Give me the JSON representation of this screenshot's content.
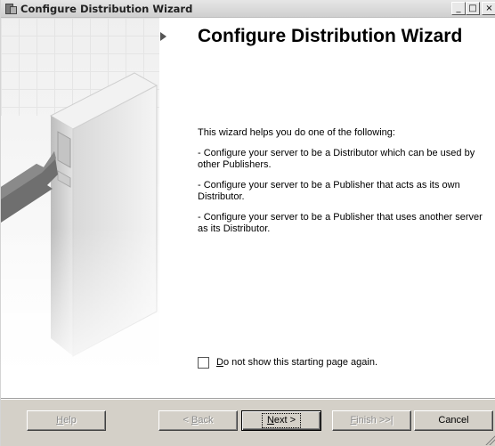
{
  "window": {
    "title": "Configure Distribution Wizard",
    "controls": {
      "minimize": "_",
      "maximize": "□",
      "close": "×"
    }
  },
  "page": {
    "heading": "Configure Distribution Wizard",
    "intro": "This wizard helps you do one of the following:",
    "options": [
      "- Configure your server to be a Distributor which can be used by other Publishers.",
      "- Configure your server to be a Publisher that acts as its own Distributor.",
      "- Configure your server to be a Publisher that uses another server as its Distributor."
    ],
    "checkbox": {
      "hotkey": "D",
      "rest": "o not show this starting page again.",
      "checked": false
    }
  },
  "buttons": {
    "help": {
      "hotkey": "H",
      "rest": "elp"
    },
    "back": {
      "pre": "< ",
      "hotkey": "B",
      "rest": "ack"
    },
    "next": {
      "hotkey": "N",
      "rest": "ext >"
    },
    "finish": {
      "hotkey": "F",
      "rest": "inish >>|"
    },
    "cancel": "Cancel"
  },
  "colors": {
    "dialog_face": "#d4d0c8",
    "content_bg": "#ffffff",
    "heading": "#000000"
  },
  "icons": {
    "app": "server-wizard-icon",
    "section_marker": "triangle-right-icon",
    "illustration": "server-tower-arrow"
  }
}
